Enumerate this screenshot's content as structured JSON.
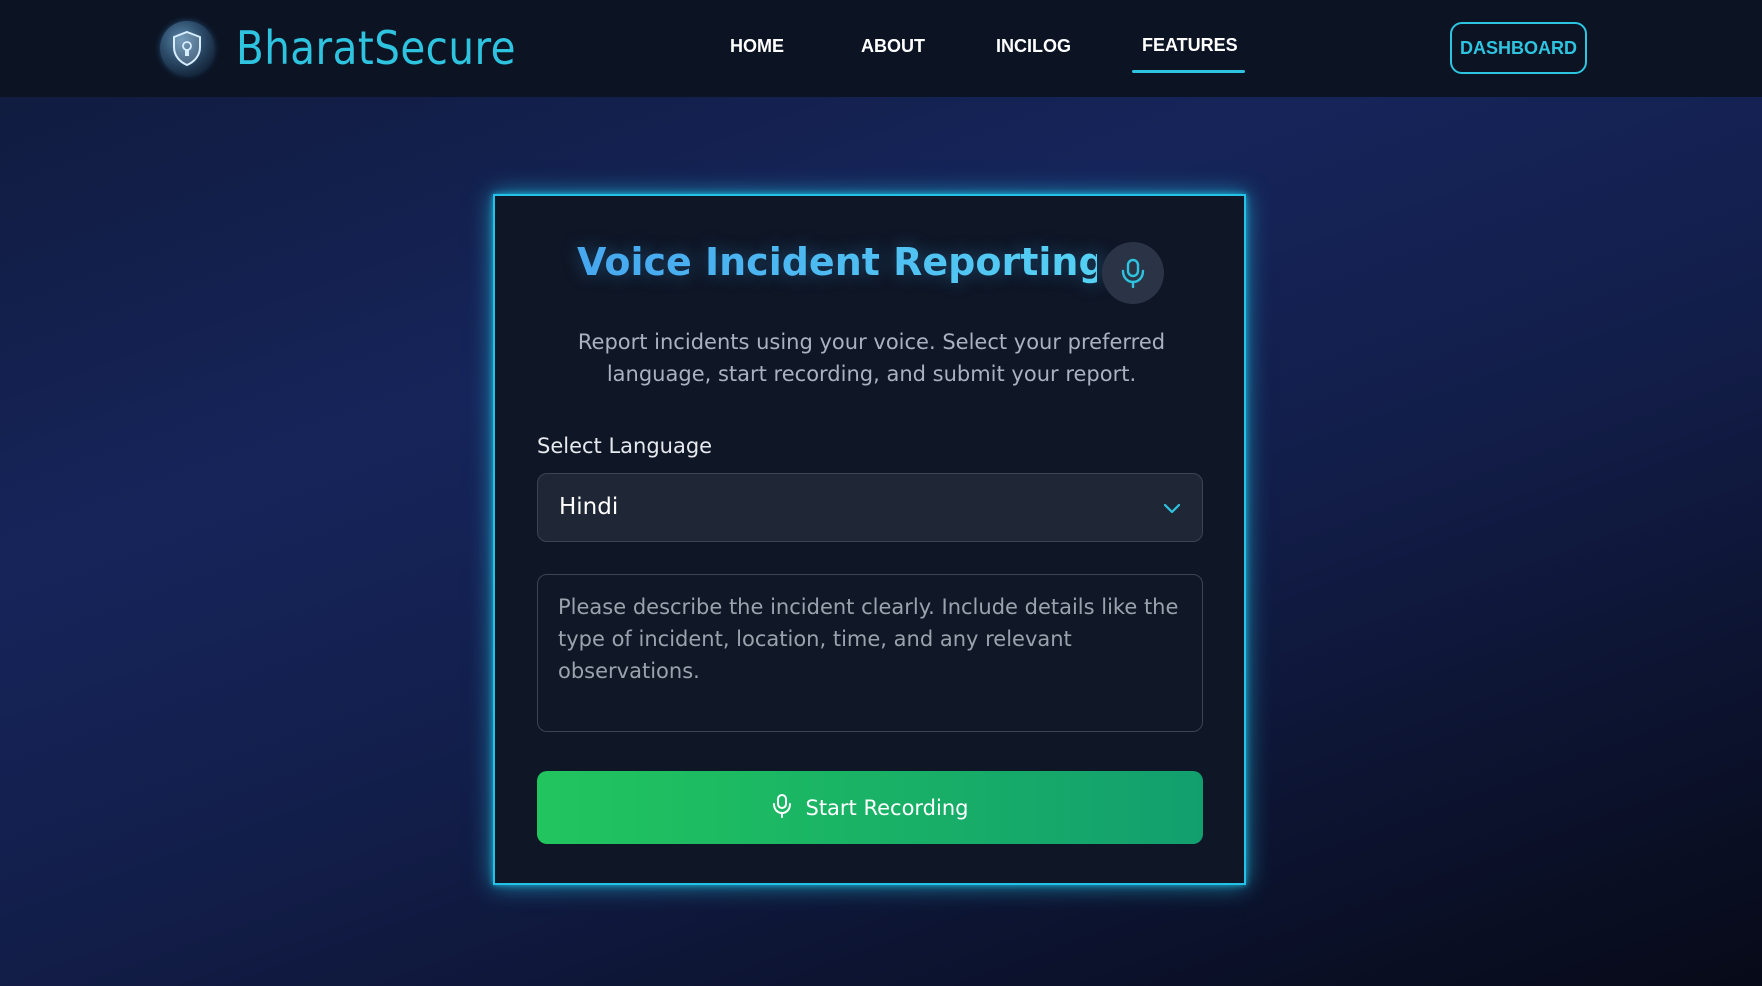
{
  "header": {
    "brand": "BharatSecure",
    "nav": [
      {
        "label": "HOME"
      },
      {
        "label": "ABOUT"
      },
      {
        "label": "INCILOG"
      },
      {
        "label": "FEATURES",
        "active": true
      }
    ],
    "dashboard_label": "DASHBOARD",
    "logo_icon": "shield-globe-icon"
  },
  "card": {
    "title": "Voice Incident Reporting",
    "title_icon": "microphone-icon",
    "description": "Report incidents using your voice. Select your preferred language, start recording, and submit your report.",
    "language_label": "Select Language",
    "language_value": "Hindi",
    "description_placeholder": "Please describe the incident clearly. Include details like the type of incident, location, time, and any relevant observations.",
    "record_label": "Start Recording",
    "record_icon": "microphone-icon"
  },
  "colors": {
    "accent": "#2ec4e0",
    "record_gradient_start": "#21c55e",
    "record_gradient_end": "#129f6e",
    "card_bg": "#0f1626"
  }
}
